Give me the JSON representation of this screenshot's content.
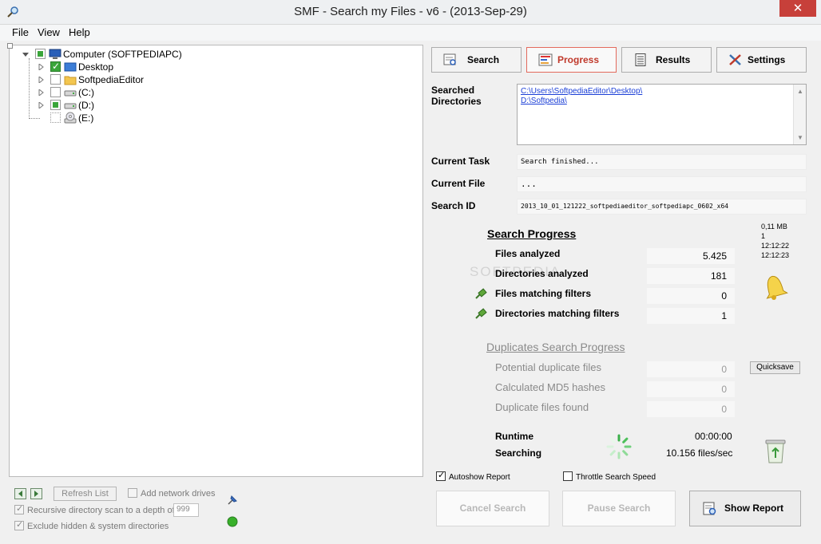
{
  "window": {
    "title": "SMF - Search my Files - v6 - (2013-Sep-29)",
    "close": "✕"
  },
  "menu": [
    "File",
    "View",
    "Help"
  ],
  "tree": {
    "root": "Computer (SOFTPEDIAPC)",
    "items": [
      "Desktop",
      "SoftpediaEditor",
      "(C:)",
      "(D:)",
      "(E:)"
    ]
  },
  "bottom_left": {
    "refresh": "Refresh List",
    "add_network": "Add network drives",
    "recursive": "Recursive directory scan to a depth of",
    "depth": "999",
    "exclude": "Exclude hidden & system directories"
  },
  "tabs": [
    "Search",
    "Progress",
    "Results",
    "Settings"
  ],
  "labels": {
    "searched_dirs_1": "Searched",
    "searched_dirs_2": "Directories",
    "current_task": "Current Task",
    "current_file": "Current File",
    "search_id": "Search ID"
  },
  "values": {
    "dir1": "C:\\Users\\SoftpediaEditor\\Desktop\\",
    "dir2": "D:\\Softpedia\\",
    "current_task": "Search finished...",
    "current_file": "...",
    "search_id": "2013_10_01_121222_softpediaeditor_softpediapc_0602_x64"
  },
  "side_info": [
    "0,11 MB",
    "1",
    "12:12:22",
    "12:12:23"
  ],
  "search_progress": {
    "title": "Search Progress",
    "rows": [
      {
        "label": "Files analyzed",
        "value": "5.425"
      },
      {
        "label": "Directories analyzed",
        "value": "181"
      },
      {
        "label": "Files matching filters",
        "value": "0"
      },
      {
        "label": "Directories matching filters",
        "value": "1"
      }
    ]
  },
  "duplicates": {
    "title": "Duplicates Search Progress",
    "quicksave": "Quicksave",
    "rows": [
      {
        "label": "Potential duplicate files",
        "value": "0"
      },
      {
        "label": "Calculated MD5 hashes",
        "value": "0"
      },
      {
        "label": "Duplicate files found",
        "value": "0"
      }
    ]
  },
  "runtime": {
    "label": "Runtime",
    "value": "00:00:00"
  },
  "searching": {
    "label": "Searching",
    "value": "10.156 files/sec"
  },
  "options": {
    "autoshow": "Autoshow Report",
    "throttle": "Throttle Search Speed"
  },
  "buttons": {
    "cancel": "Cancel Search",
    "pause": "Pause Search",
    "show": "Show Report"
  },
  "watermark": "SOFTPEDIA",
  "colors": {
    "active_tab": "#e36a5d",
    "link": "#1a3ed6",
    "check_green": "#3aa53a",
    "close_red": "#c7403a"
  }
}
